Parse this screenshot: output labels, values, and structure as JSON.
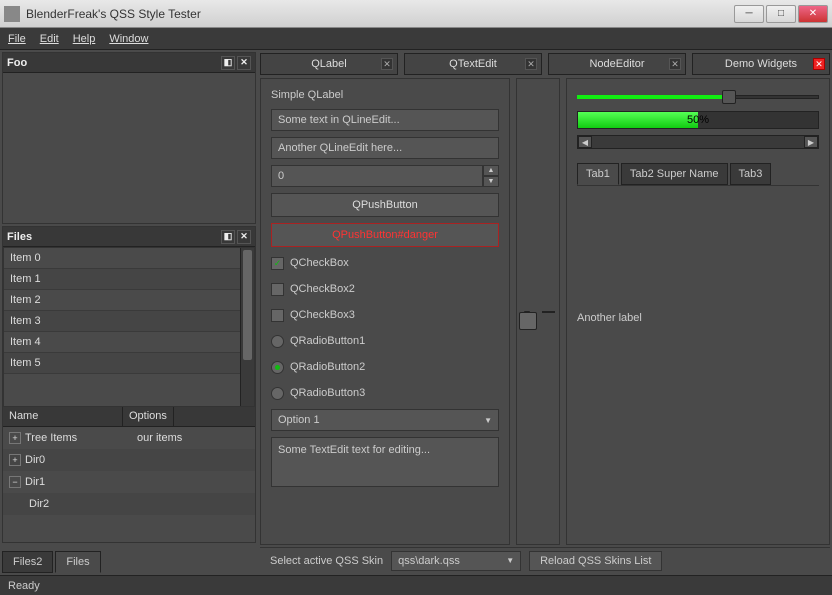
{
  "window": {
    "title": "BlenderFreak's QSS Style Tester"
  },
  "menu": {
    "file": "File",
    "edit": "Edit",
    "help": "Help",
    "window": "Window"
  },
  "docks": {
    "foo": {
      "title": "Foo"
    },
    "files": {
      "title": "Files",
      "items": [
        "Item 0",
        "Item 1",
        "Item 2",
        "Item 3",
        "Item 4",
        "Item 5"
      ],
      "tree_cols": {
        "name": "Name",
        "options": "Options"
      },
      "tree": [
        {
          "label": "Tree Items",
          "options": "our items",
          "expand": true
        },
        {
          "label": "Dir0",
          "expand": true
        },
        {
          "label": "Dir1",
          "expand": true
        },
        {
          "label": "Dir2",
          "indent": true
        }
      ]
    }
  },
  "left_tabs": {
    "files2": "Files2",
    "files": "Files"
  },
  "main_tabs": {
    "qlabel": "QLabel",
    "qtextedit": "QTextEdit",
    "nodeeditor": "NodeEditor",
    "demo": "Demo Widgets"
  },
  "form": {
    "simple_label": "Simple QLabel",
    "line1": "Some text in QLineEdit...",
    "line2": "Another QLineEdit here...",
    "spin": "0",
    "btn1": "QPushButton",
    "btn2": "QPushButton#danger",
    "cb1": "QCheckBox",
    "cb2": "QCheckBox2",
    "cb3": "QCheckBox3",
    "rb1": "QRadioButton1",
    "rb2": "QRadioButton2",
    "rb3": "QRadioButton3",
    "combo": "Option 1",
    "textedit": "Some TextEdit text for editing..."
  },
  "right_panel": {
    "progress_text": "50%",
    "tabs": {
      "t1": "Tab1",
      "t2": "Tab2 Super Name",
      "t3": "Tab3"
    },
    "another": "Another label"
  },
  "bottom": {
    "label": "Select active QSS Skin",
    "combo": "qss\\dark.qss",
    "reload": "Reload QSS Skins List"
  },
  "status": "Ready"
}
